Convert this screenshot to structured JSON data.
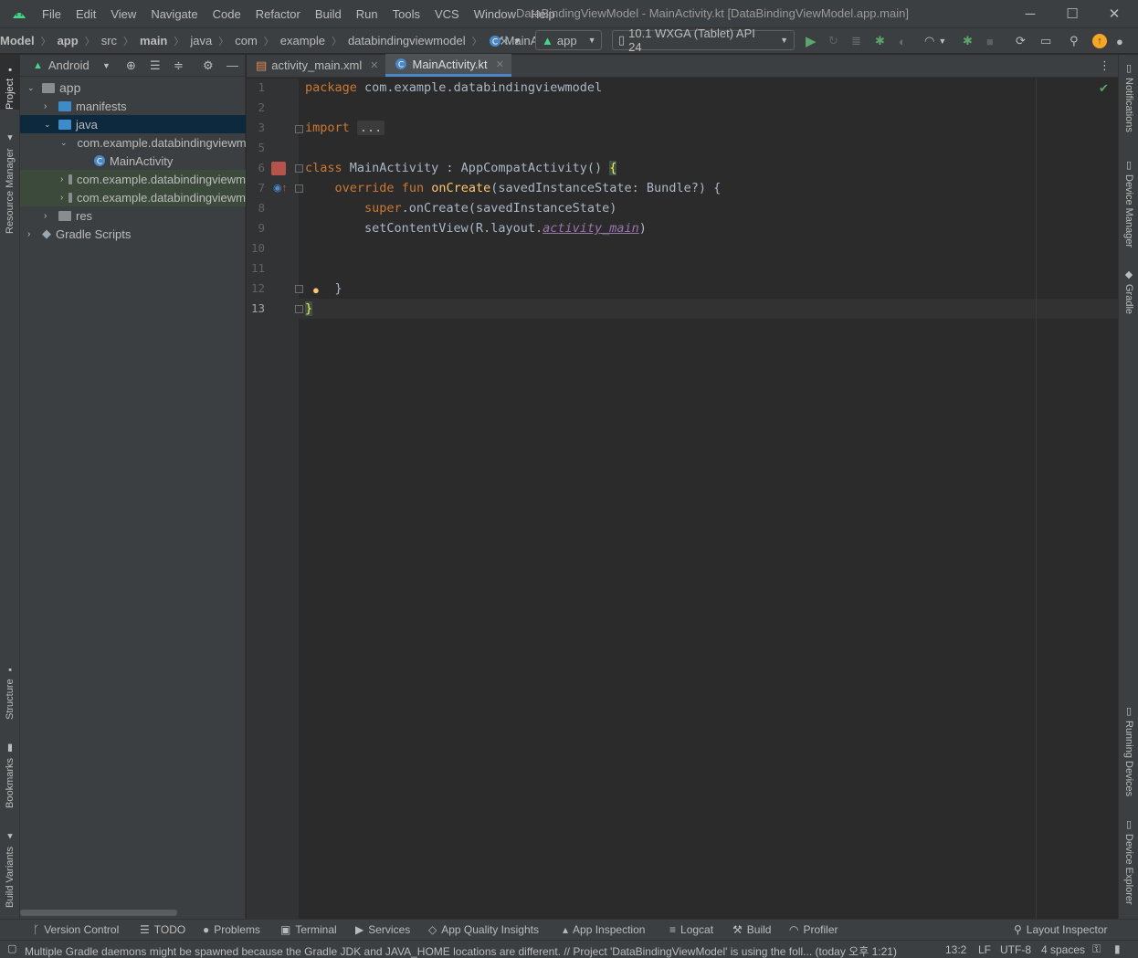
{
  "window": {
    "title": "DataBindingViewModel - MainActivity.kt [DataBindingViewModel.app.main]",
    "menu": [
      "File",
      "Edit",
      "View",
      "Navigate",
      "Code",
      "Refactor",
      "Build",
      "Run",
      "Tools",
      "VCS",
      "Window",
      "Help"
    ],
    "controls": {
      "minimize": "─",
      "maximize": "☐",
      "close": "✕"
    }
  },
  "breadcrumbs": [
    "Model",
    "app",
    "src",
    "main",
    "java",
    "com",
    "example",
    "databindingviewmodel",
    "MainActivity"
  ],
  "toolbar": {
    "run_config": "app",
    "device": "10.1  WXGA (Tablet) API 24"
  },
  "project_panel": {
    "view": "Android",
    "tree": [
      {
        "label": "app",
        "level": 0,
        "expanded": true
      },
      {
        "label": "manifests",
        "level": 1,
        "expanded": false
      },
      {
        "label": "java",
        "level": 1,
        "expanded": true,
        "selected": true
      },
      {
        "label": "com.example.databindingviewm",
        "level": 2,
        "expanded": true
      },
      {
        "label": "MainActivity",
        "level": 3
      },
      {
        "label": "com.example.databindingviewm",
        "level": 2,
        "expanded": false
      },
      {
        "label": "com.example.databindingviewm",
        "level": 2,
        "expanded": false
      },
      {
        "label": "res",
        "level": 1,
        "expanded": false
      },
      {
        "label": "Gradle Scripts",
        "level": 0,
        "expanded": false
      }
    ]
  },
  "left_tabs": [
    "Project",
    "Resource Manager",
    "Structure",
    "Bookmarks",
    "Build Variants"
  ],
  "right_tabs": [
    "Notifications",
    "Device Manager",
    "Gradle",
    "Running Devices",
    "Device Explorer"
  ],
  "editor": {
    "tabs": [
      {
        "label": "activity_main.xml",
        "active": false
      },
      {
        "label": "MainActivity.kt",
        "active": true
      }
    ],
    "current_line": 13,
    "lines": [
      {
        "n": "1",
        "text": "package com.example.databindingviewmodel"
      },
      {
        "n": "2",
        "text": ""
      },
      {
        "n": "3",
        "text": "import ..."
      },
      {
        "n": "5",
        "text": ""
      },
      {
        "n": "6",
        "text": "class MainActivity : AppCompatActivity() {"
      },
      {
        "n": "7",
        "text": "    override fun onCreate(savedInstanceState: Bundle?) {"
      },
      {
        "n": "8",
        "text": "        super.onCreate(savedInstanceState)"
      },
      {
        "n": "9",
        "text": "        setContentView(R.layout.activity_main)"
      },
      {
        "n": "10",
        "text": ""
      },
      {
        "n": "11",
        "text": ""
      },
      {
        "n": "12",
        "text": "    }"
      },
      {
        "n": "13",
        "text": "}"
      }
    ]
  },
  "bottom_tools": [
    "Version Control",
    "TODO",
    "Problems",
    "Terminal",
    "Services",
    "App Quality Insights",
    "App Inspection",
    "Logcat",
    "Build",
    "Profiler",
    "Layout Inspector"
  ],
  "status": {
    "message": "Multiple Gradle daemons might be spawned because the Gradle JDK and JAVA_HOME locations are different. // Project 'DataBindingViewModel' is using the foll... (today 오후 1:21)",
    "position": "13:2",
    "line_sep": "LF",
    "encoding": "UTF-8",
    "indent": "4 spaces"
  },
  "colors": {
    "keyword": "#cc7832",
    "function": "#ffc66d",
    "field": "#9876aa",
    "text": "#a9b7c6",
    "accent": "#4a88c7",
    "selection": "#0d293e"
  }
}
